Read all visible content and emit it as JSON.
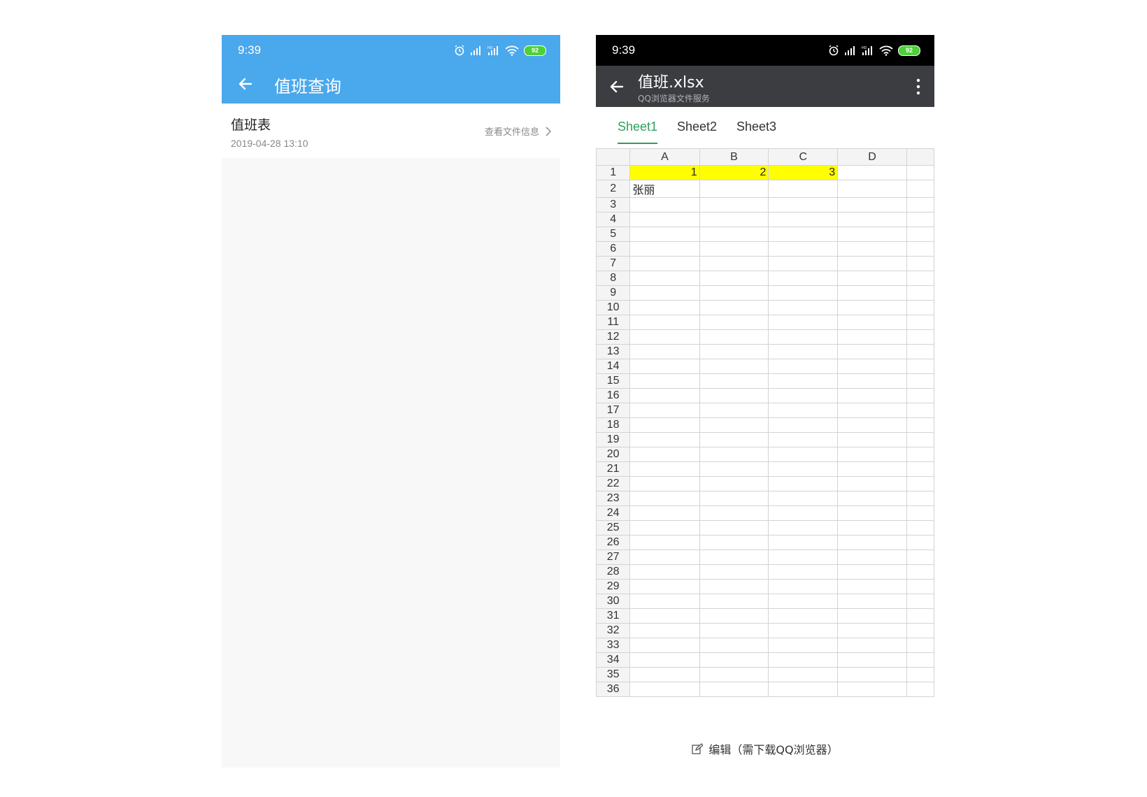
{
  "left_phone": {
    "status": {
      "time": "9:39",
      "battery": "92"
    },
    "toolbar": {
      "title": "值班查询",
      "back_icon": "arrow-left-icon"
    },
    "file": {
      "name": "值班表",
      "date": "2019-04-28 13:10",
      "info_link": "查看文件信息"
    }
  },
  "right_phone": {
    "status": {
      "time": "9:39",
      "battery": "92"
    },
    "toolbar": {
      "title": "值班.xlsx",
      "subtitle": "QQ浏览器文件服务",
      "back_icon": "arrow-left-icon",
      "menu_icon": "more-vertical-icon"
    },
    "sheet_tabs": [
      "Sheet1",
      "Sheet2",
      "Sheet3"
    ],
    "active_tab": "Sheet1",
    "active_color": "#2e9f5a",
    "grid": {
      "columns": [
        "A",
        "B",
        "C",
        "D"
      ],
      "row_count": 36,
      "highlight_color": "#ffff00",
      "cells": {
        "A1": "1",
        "B1": "2",
        "C1": "3",
        "A2": "张丽"
      }
    },
    "bottom_bar": {
      "edit_label": "编辑（需下载QQ浏览器）",
      "edit_icon": "edit-icon"
    }
  }
}
